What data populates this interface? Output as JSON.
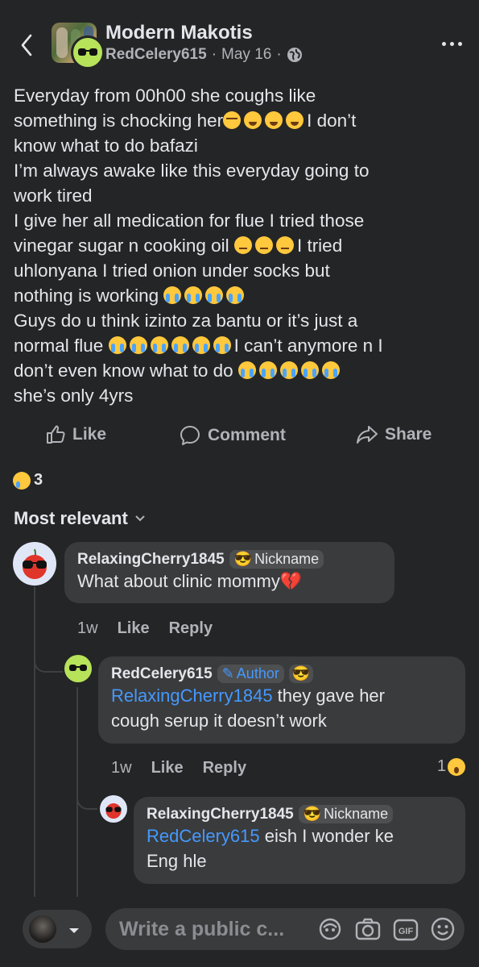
{
  "header": {
    "group_name": "Modern Makotis",
    "author": "RedCelery615",
    "date": "May 16",
    "separator": "·"
  },
  "post": {
    "lines": [
      "Everyday from 00h00 she coughs like",
      "something is chocking her",
      "I don’t",
      "know what to do bafazi",
      "I’m always awake like this everyday going to",
      "work tired",
      "I give her all medication for flue I tried those",
      "vinegar sugar n cooking oil",
      "I tried",
      "uhlonyana I tried onion under socks but",
      "nothing is working",
      "Guys do u think izinto za bantu or it’s just a",
      "normal flue",
      "I can’t anymore n I",
      "don’t even know what to do",
      "she’s only 4yrs"
    ]
  },
  "actions": {
    "like": "Like",
    "comment": "Comment",
    "share": "Share"
  },
  "reactions": {
    "count": "3"
  },
  "sort": {
    "label": "Most relevant"
  },
  "comments": [
    {
      "name": "RelaxingCherry1845",
      "badge": "Nickname",
      "text": "What about clinic mommy",
      "time": "1w",
      "like": "Like",
      "reply": "Reply"
    },
    {
      "name": "RedCelery615",
      "badge": "Author",
      "mention": "RelaxingCherry1845",
      "text_line1": " they gave her",
      "text_line2": "cough serup it doesn’t work",
      "time": "1w",
      "like": "Like",
      "reply": "Reply",
      "reaction_count": "1"
    },
    {
      "name": "RelaxingCherry1845",
      "badge": "Nickname",
      "mention": "RedCelery615",
      "text_line1": " eish I wonder ke",
      "text_line2": "Eng hle"
    }
  ],
  "composer": {
    "placeholder": "Write a public c..."
  },
  "colors": {
    "background": "#242526",
    "bubble": "#3a3b3c",
    "mention": "#4599ff",
    "secondary_text": "#b0b3b8"
  }
}
